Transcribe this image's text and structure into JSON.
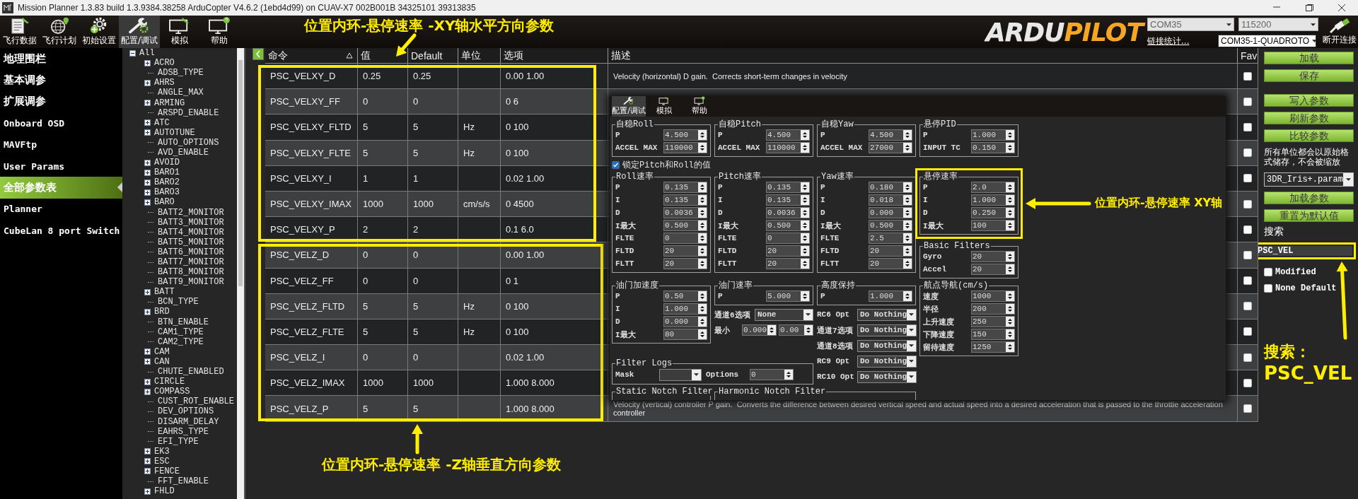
{
  "window": {
    "title": "Mission Planner 1.3.83 build 1.3.9384.38258 ArduCopter V4.6.2 (1ebd4d99) on CUAV-X7 002B001B 34325101 39313835"
  },
  "toolbar": {
    "tabs": [
      {
        "label": "飞行数据",
        "selected": false
      },
      {
        "label": "飞行计划",
        "selected": false
      },
      {
        "label": "初始设置",
        "selected": false
      },
      {
        "label": "配置/调试",
        "selected": true
      },
      {
        "label": "模拟",
        "selected": false
      },
      {
        "label": "帮助",
        "selected": false
      }
    ],
    "logo_parts": [
      "ARDU",
      "PILOT"
    ],
    "port": "COM35",
    "baud": "115200",
    "link_stats": "链接统计...",
    "vehicle": "COM35-1-QUADROTO",
    "disconnect": "断开连接"
  },
  "sidebar": {
    "items": [
      {
        "label": "地理围栏",
        "selected": false
      },
      {
        "label": "基本调参",
        "selected": false
      },
      {
        "label": "扩展调参",
        "selected": false
      },
      {
        "label": "Onboard OSD",
        "selected": false
      },
      {
        "label": "MAVFtp",
        "selected": false
      },
      {
        "label": "User Params",
        "selected": false
      },
      {
        "label": "全部参数表",
        "selected": true
      },
      {
        "label": "Planner",
        "selected": false
      },
      {
        "label": "CubeLan 8 port Switch",
        "selected": false
      }
    ]
  },
  "tree": {
    "label": "All",
    "kind": "group",
    "expanded": true,
    "children": [
      {
        "label": "ACRO",
        "kind": "group",
        "expanded": false
      },
      {
        "label": "ADSB_TYPE",
        "kind": "leaf"
      },
      {
        "label": "AHRS",
        "kind": "group",
        "expanded": false
      },
      {
        "label": "ANGLE_MAX",
        "kind": "leaf"
      },
      {
        "label": "ARMING",
        "kind": "group",
        "expanded": false
      },
      {
        "label": "ARSPD_ENABLE",
        "kind": "leaf"
      },
      {
        "label": "ATC",
        "kind": "group",
        "expanded": false
      },
      {
        "label": "AUTOTUNE",
        "kind": "group",
        "expanded": false
      },
      {
        "label": "AUTO_OPTIONS",
        "kind": "leaf"
      },
      {
        "label": "AVD_ENABLE",
        "kind": "leaf"
      },
      {
        "label": "AVOID",
        "kind": "group",
        "expanded": false
      },
      {
        "label": "BARO1",
        "kind": "group",
        "expanded": false
      },
      {
        "label": "BARO2",
        "kind": "group",
        "expanded": false
      },
      {
        "label": "BARO3",
        "kind": "group",
        "expanded": false
      },
      {
        "label": "BARO",
        "kind": "group",
        "expanded": false
      },
      {
        "label": "BATT2_MONITOR",
        "kind": "leaf"
      },
      {
        "label": "BATT3_MONITOR",
        "kind": "leaf"
      },
      {
        "label": "BATT4_MONITOR",
        "kind": "leaf"
      },
      {
        "label": "BATT5_MONITOR",
        "kind": "leaf"
      },
      {
        "label": "BATT6_MONITOR",
        "kind": "leaf"
      },
      {
        "label": "BATT7_MONITOR",
        "kind": "leaf"
      },
      {
        "label": "BATT8_MONITOR",
        "kind": "leaf"
      },
      {
        "label": "BATT9_MONITOR",
        "kind": "leaf"
      },
      {
        "label": "BATT",
        "kind": "group",
        "expanded": false
      },
      {
        "label": "BCN_TYPE",
        "kind": "leaf"
      },
      {
        "label": "BRD",
        "kind": "group",
        "expanded": false
      },
      {
        "label": "BTN_ENABLE",
        "kind": "leaf"
      },
      {
        "label": "CAM1_TYPE",
        "kind": "leaf"
      },
      {
        "label": "CAM2_TYPE",
        "kind": "leaf"
      },
      {
        "label": "CAM",
        "kind": "group",
        "expanded": false
      },
      {
        "label": "CAN",
        "kind": "group",
        "expanded": false
      },
      {
        "label": "CHUTE_ENABLED",
        "kind": "leaf"
      },
      {
        "label": "CIRCLE",
        "kind": "group",
        "expanded": false
      },
      {
        "label": "COMPASS",
        "kind": "group",
        "expanded": false
      },
      {
        "label": "CUST_ROT_ENABLE",
        "kind": "leaf"
      },
      {
        "label": "DEV_OPTIONS",
        "kind": "leaf"
      },
      {
        "label": "DISARM_DELAY",
        "kind": "leaf"
      },
      {
        "label": "EAHRS_TYPE",
        "kind": "leaf"
      },
      {
        "label": "EFI_TYPE",
        "kind": "leaf"
      },
      {
        "label": "EK3",
        "kind": "group",
        "expanded": false
      },
      {
        "label": "ESC",
        "kind": "group",
        "expanded": false
      },
      {
        "label": "FENCE",
        "kind": "group",
        "expanded": false
      },
      {
        "label": "FFT_ENABLE",
        "kind": "leaf"
      },
      {
        "label": "FHLD",
        "kind": "group",
        "expanded": false
      }
    ]
  },
  "table": {
    "columns": [
      {
        "label": "命令",
        "sorted": true
      },
      {
        "label": "值",
        "sorted": false
      },
      {
        "label": "Default",
        "sorted": false
      },
      {
        "label": "单位",
        "sorted": false
      },
      {
        "label": "选项",
        "sorted": false
      },
      {
        "label": "描述",
        "sorted": false
      },
      {
        "label": "Fav",
        "sorted": false
      }
    ],
    "row_groups": [
      {
        "highlighted": true,
        "rows": [
          {
            "name": "PSC_VELXY_D",
            "value": "0.25",
            "default": "0.25",
            "options": "0.00 1.00",
            "description": "Velocity (horizontal) D gain.  Corrects short-term changes in velocity",
            "fav": false
          },
          {
            "name": "PSC_VELXY_FF",
            "value": "0",
            "default": "0",
            "options": "0 6",
            "fav": false
          },
          {
            "name": "PSC_VELXY_FLTD",
            "value": "5",
            "default": "5",
            "units": "Hz",
            "options": "0 100",
            "fav": false
          },
          {
            "name": "PSC_VELXY_FLTE",
            "value": "5",
            "default": "5",
            "units": "Hz",
            "options": "0 100",
            "fav": false
          },
          {
            "name": "PSC_VELXY_I",
            "value": "1",
            "default": "1",
            "options": "0.02 1.00",
            "fav": false
          },
          {
            "name": "PSC_VELXY_IMAX",
            "value": "1000",
            "default": "1000",
            "units": "cm/s/s",
            "options": "0 4500",
            "fav": false
          },
          {
            "name": "PSC_VELXY_P",
            "value": "2",
            "default": "2",
            "options": "0.1 6.0",
            "fav": false
          }
        ]
      },
      {
        "highlighted": true,
        "rows": [
          {
            "name": "PSC_VELZ_D",
            "value": "0",
            "default": "0",
            "options": "0.00 1.00",
            "fav": false
          },
          {
            "name": "PSC_VELZ_FF",
            "value": "0",
            "default": "0",
            "options": "0 1",
            "fav": false
          },
          {
            "name": "PSC_VELZ_FLTD",
            "value": "5",
            "default": "5",
            "units": "Hz",
            "options": "0 100",
            "fav": false
          },
          {
            "name": "PSC_VELZ_FLTE",
            "value": "5",
            "default": "5",
            "units": "Hz",
            "options": "0 100",
            "fav": false
          },
          {
            "name": "PSC_VELZ_I",
            "value": "0",
            "default": "0",
            "options": "0.02 1.00",
            "fav": false
          },
          {
            "name": "PSC_VELZ_IMAX",
            "value": "1000",
            "default": "1000",
            "options": "1.000 8.000",
            "fav": false
          },
          {
            "name": "PSC_VELZ_P",
            "value": "5",
            "default": "5",
            "options": "1.000 8.000",
            "description": "Velocity (vertical) controller P gain.  Converts the difference between desired vertical speed and actual speed into a desired acceleration that is passed to the throttle acceleration controller",
            "fav": false
          }
        ]
      }
    ]
  },
  "side_panel": {
    "buttons_top": [
      "加载",
      "保存"
    ],
    "buttons_mid": [
      "写入参数",
      "刷新参数",
      "比较参数"
    ],
    "note": "所有单位都会以原始格式储存，不会被缩放",
    "param_file": "3DR_Iris+.param",
    "buttons_bottom": [
      "加载参数",
      "重置为默认值"
    ],
    "search": {
      "label": "搜索",
      "value": "PSC_VEL",
      "highlighted": true
    },
    "filters": [
      {
        "label": "Modified",
        "checked": false
      },
      {
        "label": "None Default",
        "checked": false
      }
    ]
  },
  "tuning_window": {
    "tabs": [
      {
        "label": "配置/调试",
        "selected": true
      },
      {
        "label": "模拟",
        "selected": false
      },
      {
        "label": "帮助",
        "selected": false
      }
    ],
    "attitude_groups": [
      {
        "title": "自稳Roll",
        "fields": [
          {
            "label": "P",
            "value": "4.500"
          },
          {
            "label": "ACCEL MAX",
            "value": "110000"
          }
        ]
      },
      {
        "title": "自稳Pitch",
        "fields": [
          {
            "label": "P",
            "value": "4.500"
          },
          {
            "label": "ACCEL MAX",
            "value": "110000"
          }
        ]
      },
      {
        "title": "自稳Yaw",
        "fields": [
          {
            "label": "P",
            "value": "4.500"
          },
          {
            "label": "ACCEL MAX",
            "value": "27000"
          }
        ]
      },
      {
        "title": "悬停PID",
        "fields": [
          {
            "label": "P",
            "value": "1.000"
          },
          {
            "label": "INPUT TC",
            "value": "0.150"
          }
        ]
      }
    ],
    "lock_pitch_roll": {
      "label": "锁定Pitch和Roll的值",
      "checked": true
    },
    "rate_groups": [
      {
        "title": "Roll速率",
        "fields": [
          {
            "label": "P",
            "value": "0.135"
          },
          {
            "label": "I",
            "value": "0.135"
          },
          {
            "label": "D",
            "value": "0.0036"
          },
          {
            "label": "I最大",
            "value": "0.500"
          },
          {
            "label": "FLTE",
            "value": "0"
          },
          {
            "label": "FLTD",
            "value": "20"
          },
          {
            "label": "FLTT",
            "value": "20"
          }
        ]
      },
      {
        "title": "Pitch速率",
        "fields": [
          {
            "label": "P",
            "value": "0.135"
          },
          {
            "label": "I",
            "value": "0.135"
          },
          {
            "label": "D",
            "value": "0.0036"
          },
          {
            "label": "I最大",
            "value": "0.500"
          },
          {
            "label": "FLTE",
            "value": "0"
          },
          {
            "label": "FLTD",
            "value": "20"
          },
          {
            "label": "FLTT",
            "value": "20"
          }
        ]
      },
      {
        "title": "Yaw速率",
        "fields": [
          {
            "label": "P",
            "value": "0.180"
          },
          {
            "label": "I",
            "value": "0.018"
          },
          {
            "label": "D",
            "value": "0.000"
          },
          {
            "label": "I最大",
            "value": "0.500"
          },
          {
            "label": "FLTE",
            "value": "2.5"
          },
          {
            "label": "FLTD",
            "value": "20"
          },
          {
            "label": "FLTT",
            "value": "20"
          }
        ]
      }
    ],
    "hover_rate_group": {
      "title": "悬停速率",
      "highlighted": true,
      "fields": [
        {
          "label": "P",
          "value": "2.0"
        },
        {
          "label": "I",
          "value": "1.000"
        },
        {
          "label": "D",
          "value": "0.250"
        },
        {
          "label": "I最大",
          "value": "100"
        }
      ]
    },
    "basic_filters": {
      "title": "Basic Filters",
      "fields": [
        {
          "label": "Gyro",
          "value": "20"
        },
        {
          "label": "Accel",
          "value": "20"
        }
      ]
    },
    "throttle_accel_group": {
      "title": "油门加速度",
      "fields": [
        {
          "label": "P",
          "value": "0.50"
        },
        {
          "label": "I",
          "value": "1.000"
        },
        {
          "label": "D",
          "value": "0.000"
        },
        {
          "label": "I最大",
          "value": "80"
        }
      ]
    },
    "throttle_rate_group": {
      "title": "油门速率",
      "fields": [
        {
          "label": "P",
          "value": "5.000"
        }
      ]
    },
    "ch6_option": {
      "label": "通道6选项",
      "value": "None"
    },
    "ch6_range": {
      "label": "最小",
      "min": "0.000",
      "max": "0.00"
    },
    "alt_hold_group": {
      "title": "高度保持",
      "fields": [
        {
          "label": "P",
          "value": "1.000"
        }
      ]
    },
    "rc_options": [
      {
        "label": "RC6 Opt",
        "value": "Do Nothing"
      },
      {
        "label": "通道7选项",
        "value": "Do Nothing"
      },
      {
        "label": "通道8选项",
        "value": "Do Nothing"
      },
      {
        "label": "RC9 Opt",
        "value": "Do Nothing"
      },
      {
        "label": "RC10 Opt",
        "value": "Do Nothing"
      }
    ],
    "waypoint_group": {
      "title": "航点导航(cm/s)",
      "fields": [
        {
          "label": "速度",
          "value": "1000"
        },
        {
          "label": "半径",
          "value": "200"
        },
        {
          "label": "上升速度",
          "value": "250"
        },
        {
          "label": "下降速度",
          "value": "150"
        },
        {
          "label": "留待速度",
          "value": "1250"
        }
      ]
    },
    "filter_logs": {
      "title": "Filter Logs",
      "mask_label": "Mask",
      "options_label": "Options",
      "options_value": "0"
    },
    "notch_groups": [
      "Static Notch Filter",
      "Harmonic Notch Filter"
    ]
  },
  "annotations": [
    {
      "text": "位置内环-悬停速率 -XY轴水平方向参数"
    },
    {
      "text": "位置内环-悬停速率 -Z轴垂直方向参数"
    },
    {
      "text": "位置内环-悬停速率 XY轴"
    },
    {
      "text": "搜索："
    },
    {
      "text": "PSC_VEL"
    }
  ]
}
